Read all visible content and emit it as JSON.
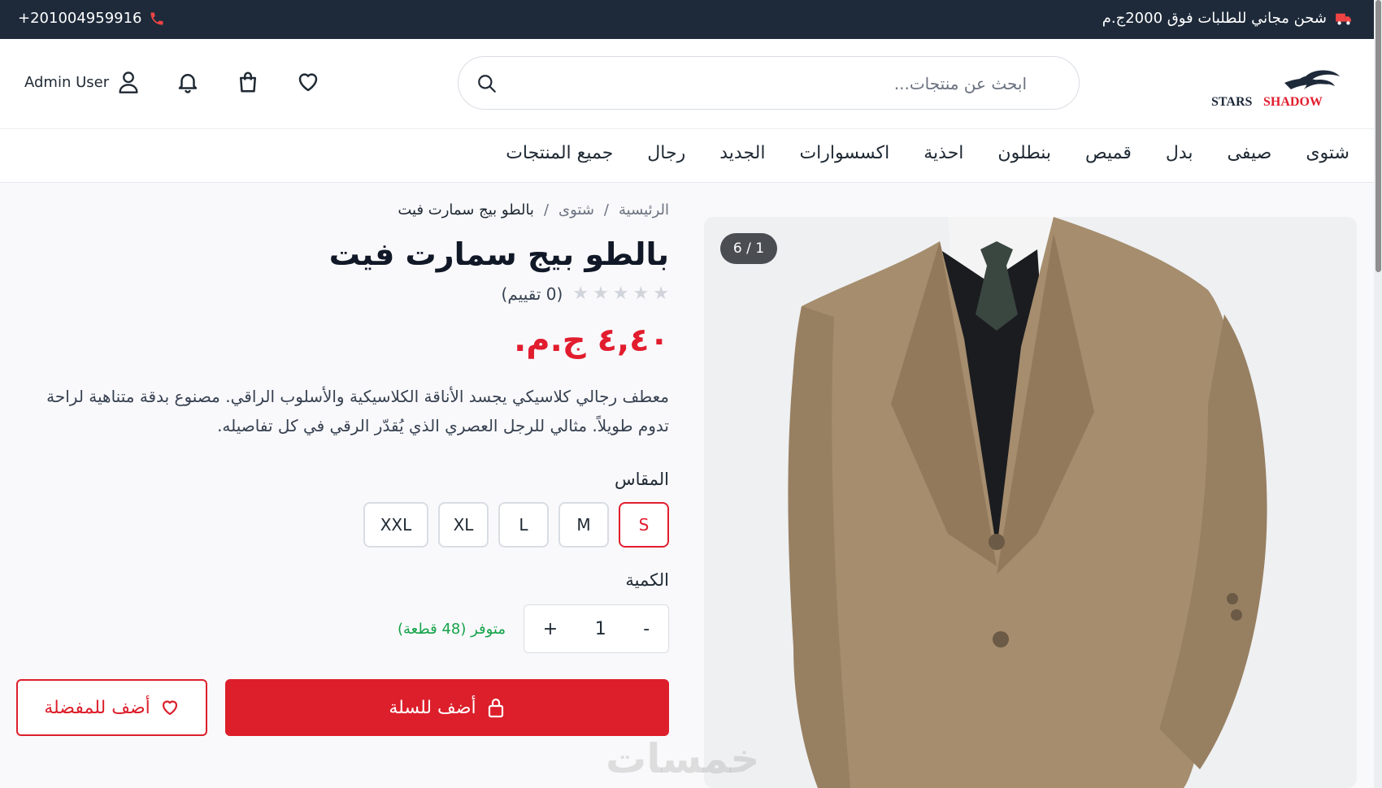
{
  "topbar": {
    "phone": "+201004959916",
    "shipping": "شحن مجاني للطلبات فوق 2000ج.م"
  },
  "header": {
    "logo_text_1": "STARS",
    "logo_text_2": "SHADOW",
    "search_placeholder": "ابحث عن منتجات...",
    "user_name": "Admin User"
  },
  "nav": [
    "شتوى",
    "صيفى",
    "بدل",
    "قميص",
    "بنطلون",
    "احذية",
    "اكسسوارات",
    "الجديد",
    "رجال",
    "جميع المنتجات"
  ],
  "gallery": {
    "counter": "6 / 1"
  },
  "breadcrumb": {
    "home": "الرئيسية",
    "sep": "/",
    "category": "شتوى",
    "current": "بالطو بيج سمارت فيت"
  },
  "product": {
    "title": "بالطو بيج سمارت فيت",
    "rating_text": "(0 تقييم)",
    "rating_value": 0,
    "price": "٤,٤٠ ج.م.",
    "description": "معطف رجالي كلاسيكي يجسد الأناقة الكلاسيكية والأسلوب الراقي. مصنوع بدقة متناهية لراحة تدوم طويلاً. مثالي للرجل العصري الذي يُقدّر الرقي في كل تفاصيله.",
    "size_label": "المقاس",
    "sizes": [
      "S",
      "M",
      "L",
      "XL",
      "XXL"
    ],
    "selected_size": "S",
    "qty_label": "الكمية",
    "qty_minus": "-",
    "qty_value": "1",
    "qty_plus": "+",
    "stock": "متوفر (48 قطعة)",
    "add_to_cart": "أضف للسلة",
    "add_to_wishlist": "أضف للمفضلة"
  },
  "watermark": "خمسات",
  "colors": {
    "topbar": "#1e2a3a",
    "accent": "#dc1f2b",
    "stock": "#16a34a"
  }
}
